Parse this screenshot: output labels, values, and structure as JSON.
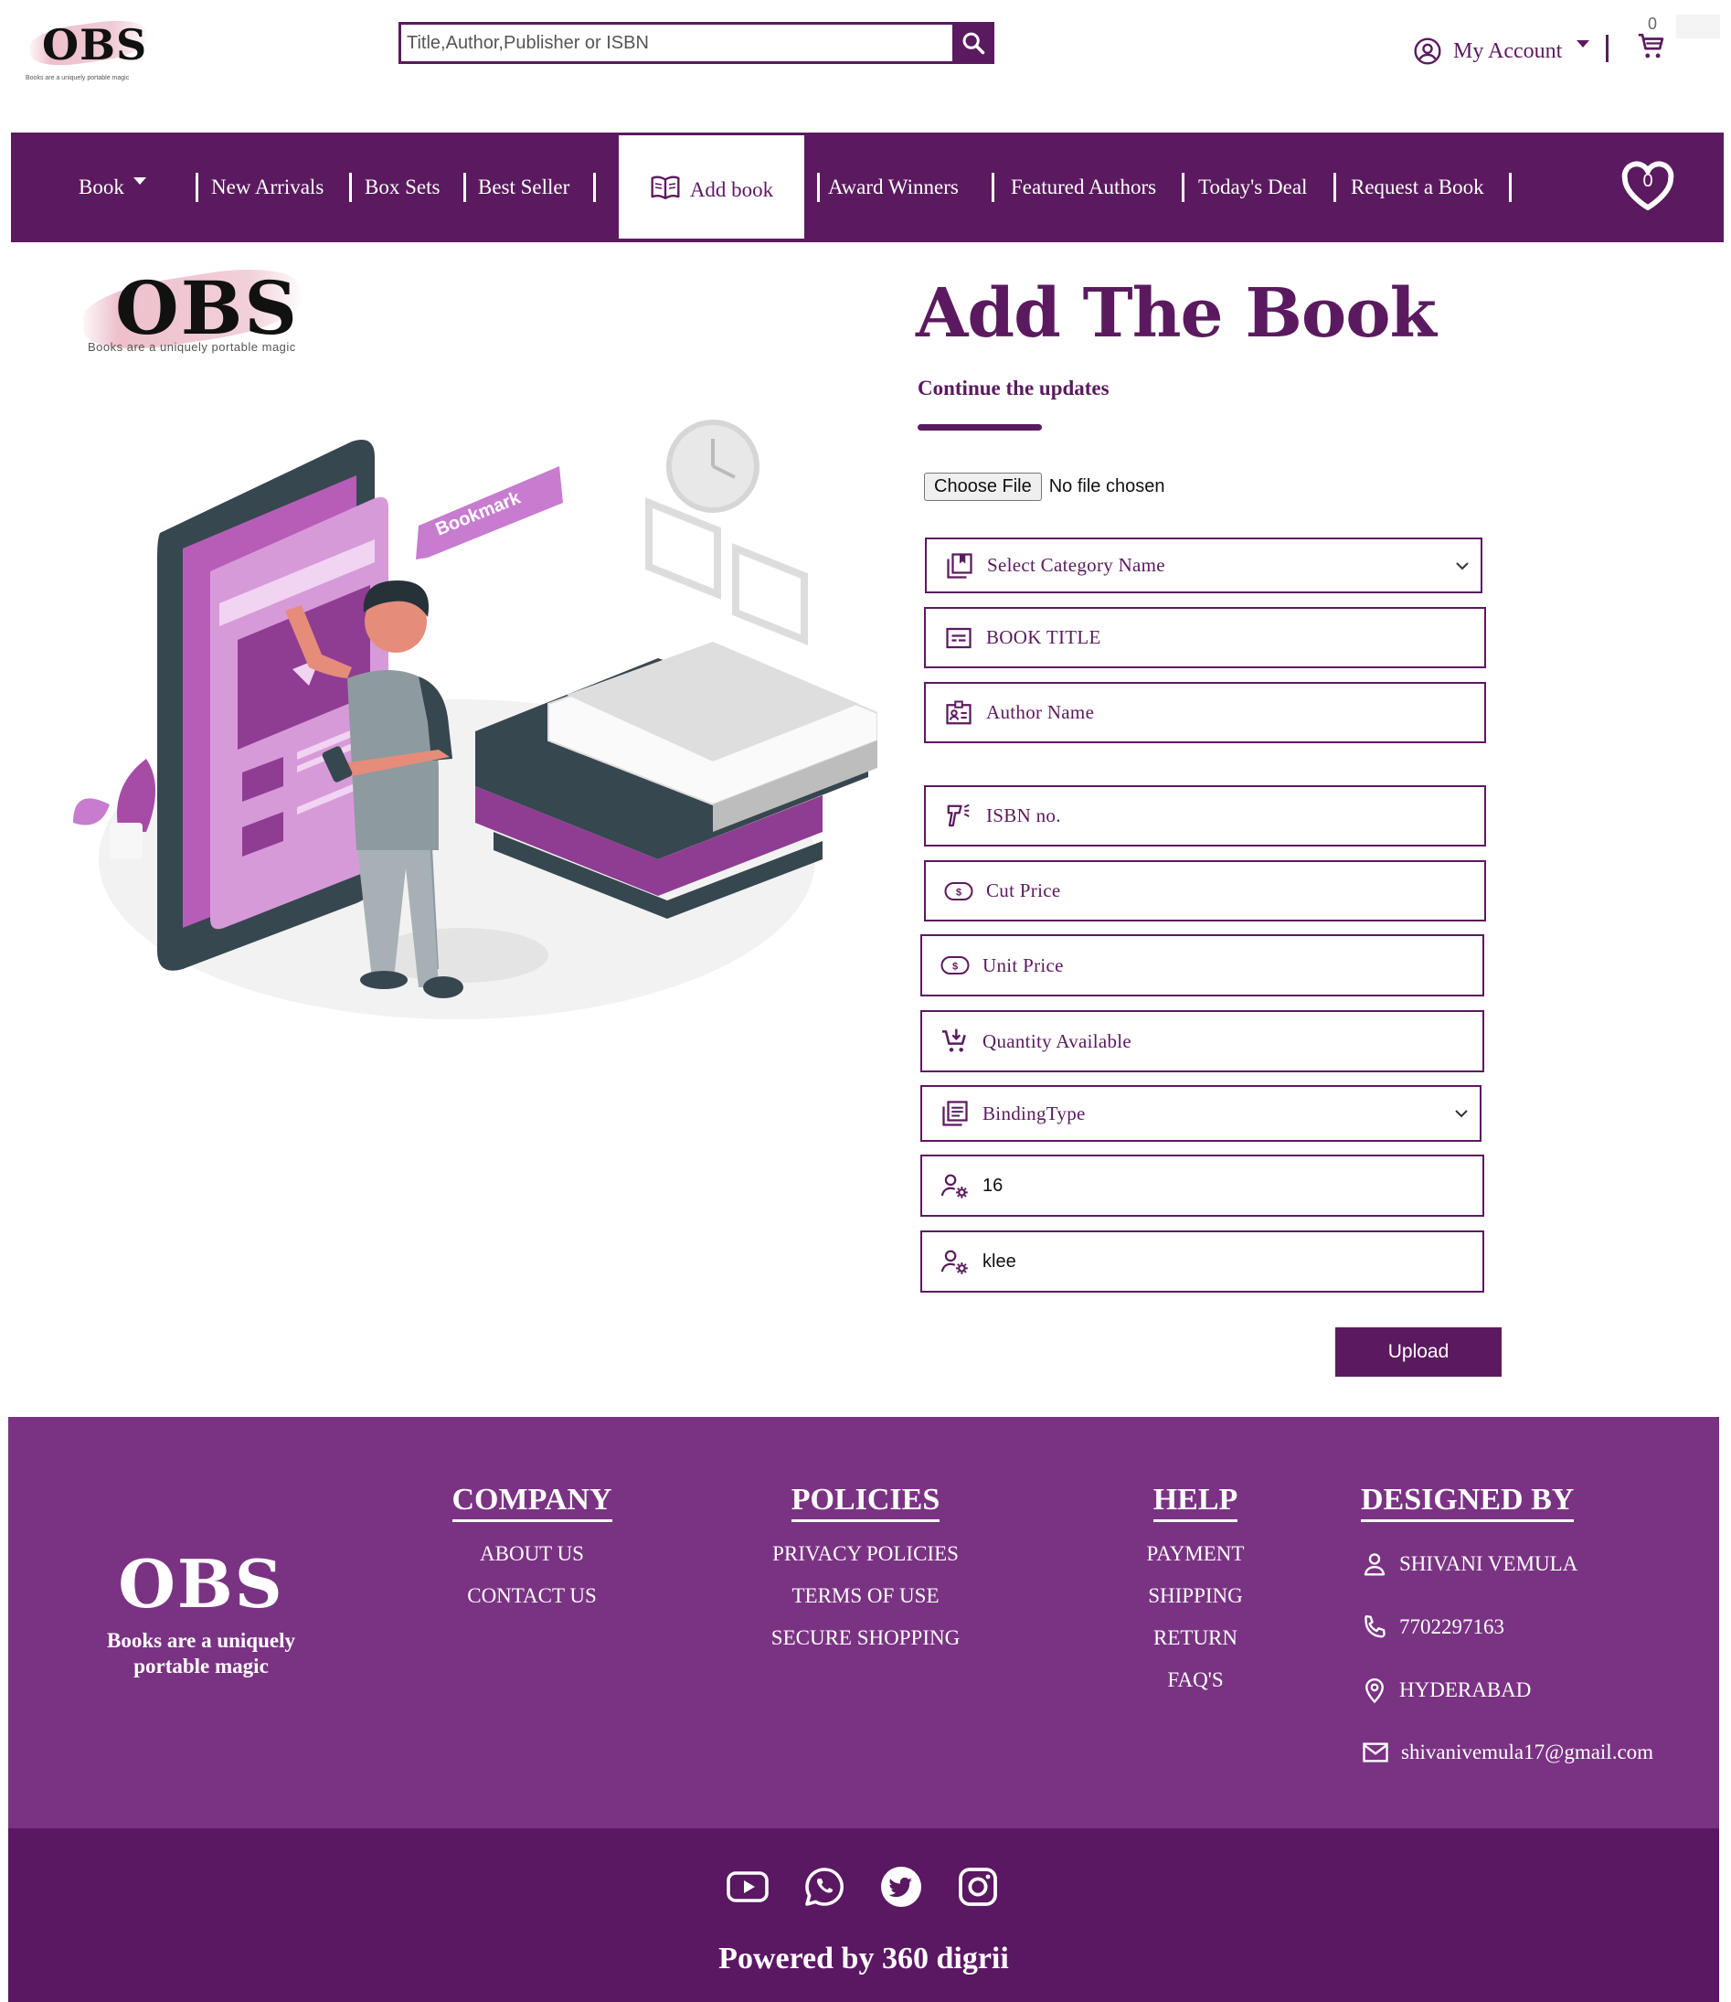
{
  "header": {
    "logo_word": "OBS",
    "logo_tagline": "Books are a uniquely portable magic",
    "search_placeholder": "Title,Author,Publisher or ISBN",
    "account_label": "My Account",
    "cart_count": "0"
  },
  "nav": {
    "items": [
      {
        "label": "Book"
      },
      {
        "label": "New Arrivals"
      },
      {
        "label": "Box Sets"
      },
      {
        "label": "Best Seller"
      },
      {
        "label": "Add book"
      },
      {
        "label": "Award Winners"
      },
      {
        "label": "Featured Authors"
      },
      {
        "label": "Today's Deal"
      },
      {
        "label": "Request a Book"
      }
    ],
    "wishlist_count": "0"
  },
  "brand_left": {
    "word": "OBS",
    "tagline": "Books are a uniquely portable magic",
    "bookmark_label": "Bookmark"
  },
  "form": {
    "title": "Add The Book",
    "subtitle": "Continue the updates",
    "file_button": "Choose File",
    "file_status": "No file chosen",
    "category_placeholder": "Select Category Name",
    "book_title_placeholder": "BOOK TITLE",
    "author_placeholder": "Author Name",
    "isbn_placeholder": "ISBN no.",
    "cut_price_placeholder": "Cut Price",
    "unit_price_placeholder": "Unit Price",
    "quantity_placeholder": "Quantity Available",
    "binding_placeholder": "BindingType",
    "field_value_1": "16",
    "field_value_2": "klee",
    "upload_label": "Upload"
  },
  "footer": {
    "brand": "OBS",
    "tagline": "Books are a uniquely portable magic",
    "company": {
      "heading": "COMPANY",
      "links": [
        "ABOUT US",
        "CONTACT US"
      ]
    },
    "policies": {
      "heading": "POLICIES",
      "links": [
        "PRIVACY POLICIES",
        "TERMS OF USE",
        "SECURE SHOPPING"
      ]
    },
    "help": {
      "heading": "HELP",
      "links": [
        "PAYMENT",
        "SHIPPING",
        "RETURN",
        "FAQ'S"
      ]
    },
    "designed_by": {
      "heading": "DESIGNED BY",
      "name": "SHIVANI VEMULA",
      "phone": "7702297163",
      "city": "HYDERABAD",
      "email": "shivanivemula17@gmail.com"
    },
    "social": [
      "youtube-icon",
      "whatsapp-icon",
      "twitter-icon",
      "instagram-icon"
    ],
    "powered_by": "Powered by 360 digrii"
  },
  "colors": {
    "primary": "#5b1a5f",
    "footer_top": "#7a3383",
    "footer_bottom": "#5a1762",
    "accent_pink": "#c77ccf"
  }
}
